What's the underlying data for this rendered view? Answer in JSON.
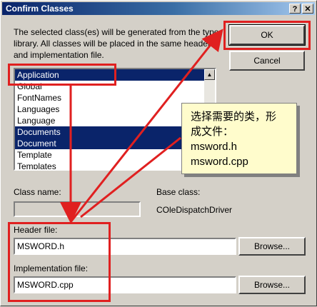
{
  "window": {
    "title": "Confirm Classes",
    "help_label": "?",
    "close_label": "✕"
  },
  "description": "The selected class(es) will be generated from the type library.  All classes will be placed in the same header and implementation file.",
  "class_list": {
    "items": [
      {
        "label": "Application",
        "selected": true
      },
      {
        "label": "Global",
        "selected": false
      },
      {
        "label": "FontNames",
        "selected": false
      },
      {
        "label": "Languages",
        "selected": false
      },
      {
        "label": "Language",
        "selected": false
      },
      {
        "label": "Documents",
        "selected": true
      },
      {
        "label": "Document",
        "selected": true
      },
      {
        "label": "Template",
        "selected": false
      },
      {
        "label": "Templates",
        "selected": false
      }
    ]
  },
  "buttons": {
    "ok": "OK",
    "cancel": "Cancel",
    "browse_header": "Browse...",
    "browse_impl": "Browse..."
  },
  "class_name": {
    "label": "Class name:",
    "value": ""
  },
  "base_class": {
    "label": "Base class:",
    "value": "COleDispatchDriver"
  },
  "header_file": {
    "label": "Header file:",
    "value": "MSWORD.h"
  },
  "implementation_file": {
    "label": "Implementation file:",
    "value": "MSWORD.cpp"
  },
  "annotation": {
    "line1": "选择需要的类，形",
    "line2": "成文件：",
    "line3": "msword.h",
    "line4": "msword.cpp"
  },
  "colors": {
    "highlight": "#0a246a",
    "annotation_red": "#e02020",
    "callout_bg": "#fffccc"
  }
}
